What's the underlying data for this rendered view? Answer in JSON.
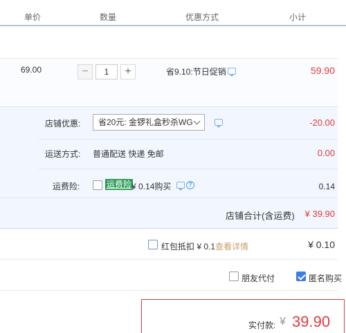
{
  "header": {
    "col_price": "单价",
    "col_qty": "数量",
    "col_promo": "优惠方式",
    "col_subtotal": "小计"
  },
  "item": {
    "price": "69.00",
    "quantity": "1",
    "minus": "−",
    "plus": "+",
    "promo": "省9.10:节日促销",
    "subtotal": "59.90"
  },
  "shop": {
    "coupon_label": "店铺优惠:",
    "coupon_selected": "省20元: 金锣礼盒秒杀WG",
    "coupon_amount": "-20.00",
    "shipping_label": "运送方式:",
    "shipping_value": "普通配送 快递 免邮",
    "shipping_fee": "0.00",
    "insurance_label": "运费险:",
    "insurance_tag": "运费险",
    "insurance_price": "¥ 0.14购买",
    "insurance_amount": "0.14",
    "total_label": "店铺合计(含运费)",
    "total_value": "¥ 39.90"
  },
  "redpacket": {
    "label": "红包抵扣 ¥ 0.1",
    "link": "查看详情",
    "value": "¥ 0.10"
  },
  "options": {
    "friend_pay": "朋友代付",
    "anonymous": "匿名购买",
    "anonymous_checked": true
  },
  "payment": {
    "label": "实付款:",
    "currency": "¥",
    "amount": "39.90"
  },
  "colors": {
    "accent_red": "#e4393c",
    "header_rule": "#b6c3d6",
    "shop_bg": "#f2f7ff",
    "insurance_tag": "#2c9c55",
    "checkbox_blue": "#3d7de0"
  },
  "icons": [
    "chat-icon",
    "help-icon",
    "chevron-down-icon",
    "checkbox-icon"
  ]
}
